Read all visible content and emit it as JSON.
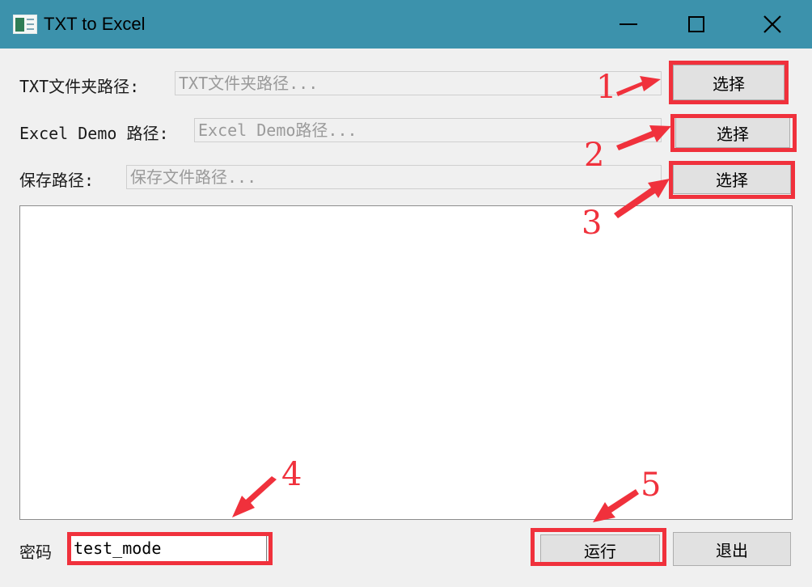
{
  "window": {
    "title": "TXT to Excel",
    "icon": "excel-file-icon",
    "controls": [
      "minimize",
      "maximize",
      "close"
    ],
    "close_glyph": "✕"
  },
  "rows": [
    {
      "label": "TXT文件夹路径:",
      "placeholder": "TXT文件夹路径...",
      "button": "选择"
    },
    {
      "label": "Excel Demo 路径:",
      "placeholder": "Excel Demo路径...",
      "button": "选择"
    },
    {
      "label": "保存路径:",
      "placeholder": "保存文件路径...",
      "button": "选择"
    }
  ],
  "password": {
    "label": "密码",
    "value": "test_mode"
  },
  "actions": {
    "run": "运行",
    "exit": "退出"
  },
  "annotations": {
    "numbers": [
      "1",
      "2",
      "3",
      "4",
      "5"
    ],
    "color": "#f0313c"
  },
  "colors": {
    "titlebar": "#3c92ac",
    "background": "#f0f0f0",
    "button": "#e1e1e1"
  }
}
